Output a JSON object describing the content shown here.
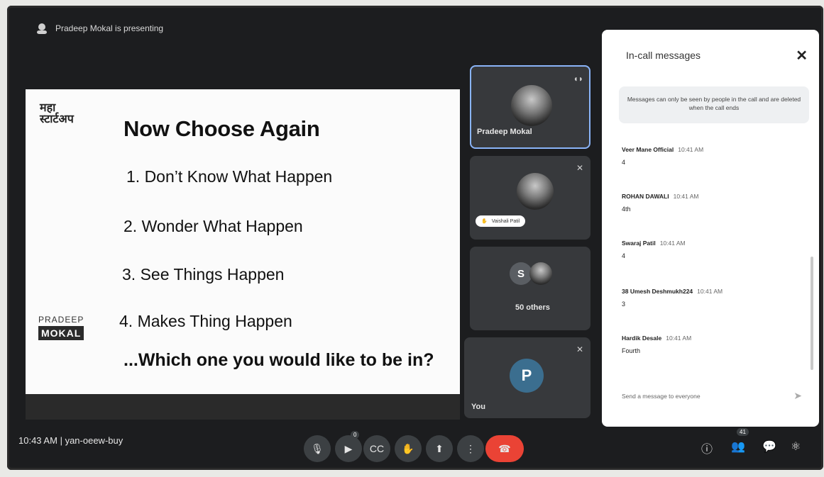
{
  "presenting": {
    "text": "Pradeep Mokal is presenting"
  },
  "slide": {
    "logo_top_line1": "महा",
    "logo_top_line2": "स्टार्टअप",
    "title": "Now Choose Again",
    "items": [
      "1.  Don’t Know What Happen",
      "2.  Wonder What Happen",
      "3.  See Things Happen",
      "4.  Makes Thing Happen"
    ],
    "question": "...Which one you would like to be in?",
    "logo_bottom_line1": "PRADEEP",
    "logo_bottom_line2": "MOKAL"
  },
  "tiles": {
    "pradeep": {
      "name": "Pradeep Mokal"
    },
    "vaishali": {
      "name": "Vaishali Patil"
    },
    "others": {
      "letter": "S",
      "label": "50 others"
    },
    "you": {
      "letter": "P",
      "label": "You"
    }
  },
  "chat": {
    "title": "In-call messages",
    "notice": "Messages can only be seen by people in the call and are deleted when the call ends",
    "messages": [
      {
        "who": "Veer Mane Official",
        "time": "10:41 AM",
        "text": "4"
      },
      {
        "who": "ROHAN DAWALI",
        "time": "10:41 AM",
        "text": "4th"
      },
      {
        "who": "Swaraj Patil",
        "time": "10:41 AM",
        "text": "4"
      },
      {
        "who": "38 Umesh Deshmukh224",
        "time": "10:41 AM",
        "text": "3"
      },
      {
        "who": "Hardik Desale",
        "time": "10:41 AM",
        "text": "Fourth"
      }
    ],
    "input_placeholder": "Send a message to everyone"
  },
  "bottom": {
    "time": "10:43 AM",
    "separator": "|",
    "meeting_code": "yan-oeew-buy",
    "people_count": "41"
  },
  "icons": {
    "mic": "mic-off-icon",
    "camera": "camera-off-icon",
    "captions": "captions-icon",
    "hand": "raise-hand-icon",
    "present": "present-icon",
    "more": "more-options-icon",
    "end": "end-call-icon"
  },
  "colors": {
    "accent": "#8ab4f8",
    "end_call": "#ea4335",
    "avatar_p": "#3b6e8f",
    "avatar_s": "#5a5e63"
  }
}
